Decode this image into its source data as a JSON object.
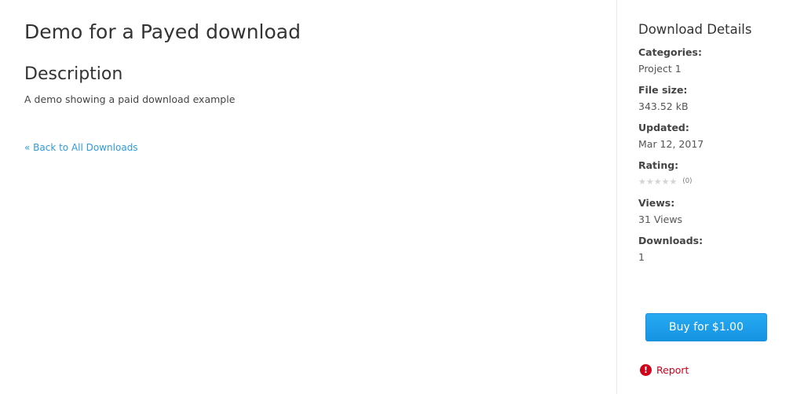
{
  "main": {
    "title": "Demo for a Payed download",
    "description_heading": "Description",
    "description_text": "A demo showing a paid download example",
    "back_link": "« Back to All Downloads"
  },
  "sidebar": {
    "heading": "Download Details",
    "details": [
      {
        "label": "Categories:",
        "value": "Project 1"
      },
      {
        "label": "File size:",
        "value": "343.52 kB"
      },
      {
        "label": "Updated:",
        "value": "Mar 12, 2017"
      },
      {
        "label": "Rating:",
        "rating_value": 0,
        "rating_max": 5,
        "rating_count": "(0)"
      },
      {
        "label": "Views:",
        "value": "31 Views"
      },
      {
        "label": "Downloads:",
        "value": "1"
      }
    ],
    "buy_button": "Buy for $1.00",
    "report": "Report"
  },
  "colors": {
    "link": "#2f9bd8",
    "button": "#1a9be8",
    "report": "#d0021b"
  },
  "icons": {
    "star": "star-icon",
    "report": "exclamation-circle-icon"
  }
}
